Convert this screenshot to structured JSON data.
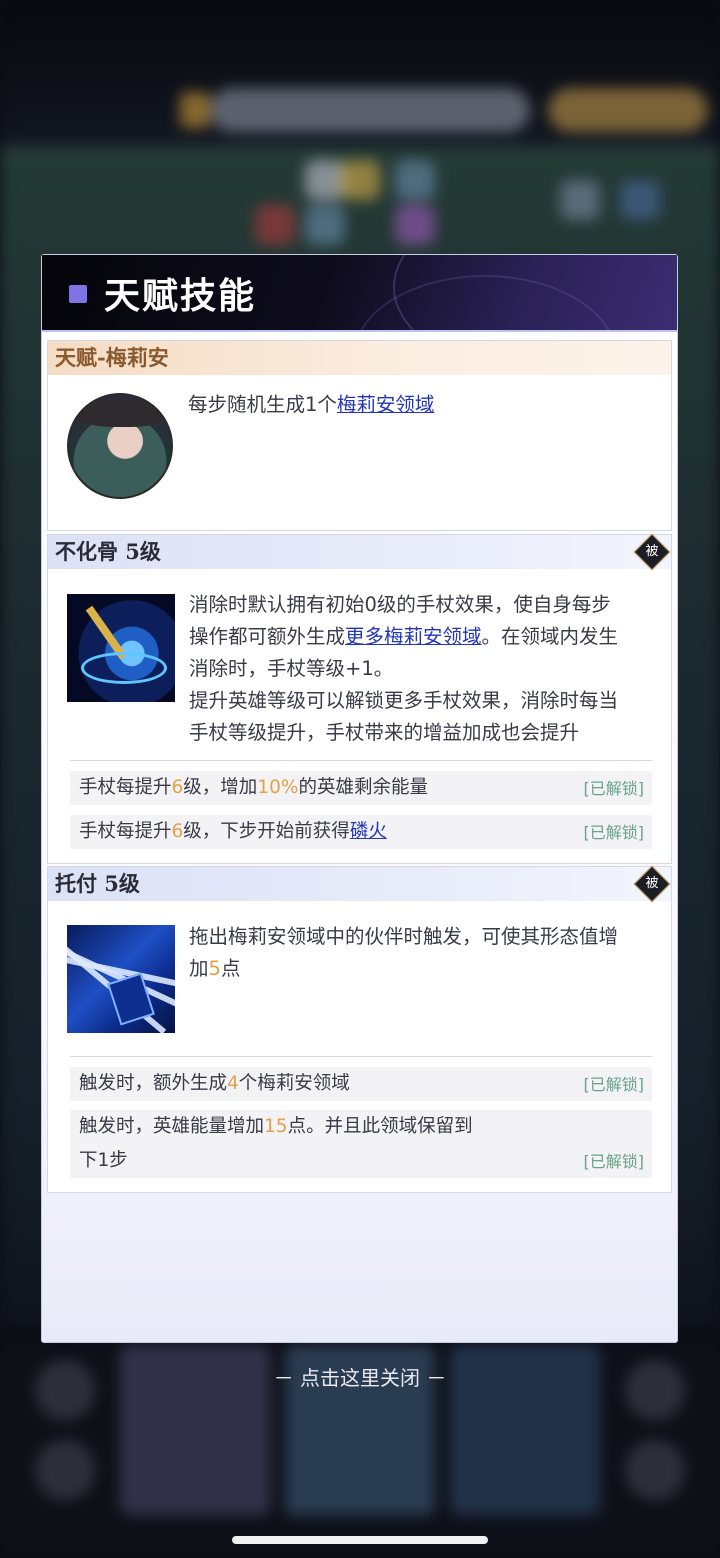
{
  "modal": {
    "title": "天赋技能",
    "close_hint": "－ 点击这里关闭 －"
  },
  "talent": {
    "header": "天赋-梅莉安",
    "desc_prefix": "每步随机生成1个",
    "desc_link": "梅莉安领域"
  },
  "skills": [
    {
      "header": "不化骨 5级",
      "badge": "被",
      "desc_lines": [
        "消除时默认拥有初始0级的手杖效果，使自身每步",
        "操作都可额外生成",
        "更多梅莉安领域",
        "。在领域内发生",
        "消除时，手杖等级+1。",
        "提升英雄等级可以解锁更多手杖效果，消除时每当",
        "手杖等级提升，手杖带来的增益加成也会提升"
      ],
      "rows": [
        {
          "a": "手杖每提升",
          "n1": "6",
          "b": "级，增加",
          "n2": "10%",
          "c": "的英雄剩余能量",
          "tag": "[已解锁]"
        },
        {
          "a": "手杖每提升",
          "n1": "6",
          "b": "级，下步开始前获得",
          "link": "磷火",
          "tag": "[已解锁]"
        }
      ]
    },
    {
      "header": "托付 5级",
      "badge": "被",
      "desc_lines": [
        "拖出梅莉安领域中的伙伴时触发，可使其形态值增",
        "加",
        "5",
        "点"
      ],
      "rows": [
        {
          "a": "触发时，额外生成",
          "n1": "4",
          "b": "个梅莉安领域",
          "tag": "[已解锁]"
        },
        {
          "a": "触发时，英雄能量增加",
          "n1": "15",
          "b": "点。并且此领域保留到",
          "c": "下1步",
          "tag": "[已解锁]"
        }
      ]
    }
  ]
}
